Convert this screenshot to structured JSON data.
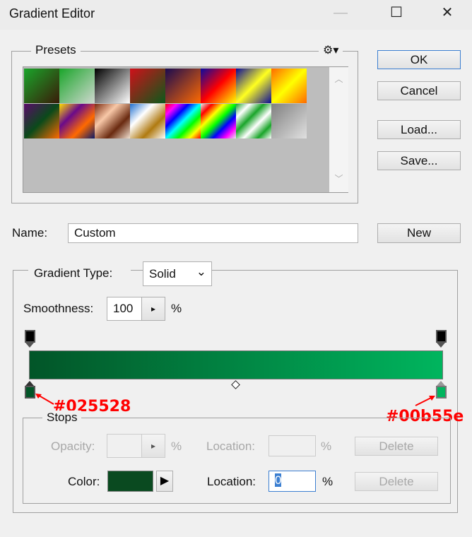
{
  "window": {
    "title": "Gradient Editor",
    "minimize": "—",
    "maximize": "☐",
    "close": "✕"
  },
  "presets": {
    "label": "Presets",
    "gear": "⚙▾",
    "scroll_up": "︿",
    "scroll_down": "﹀",
    "items": [
      [
        "135deg",
        "#1aa52a",
        "#3a1a08"
      ],
      [
        "135deg",
        "#1aa52a",
        "#cfd8cf"
      ],
      [
        "135deg",
        "#000000",
        "#ffffff"
      ],
      [
        "135deg",
        "#d0101a",
        "#0a5a1a"
      ],
      [
        "135deg",
        "#1a0a50",
        "#ff6a00"
      ],
      [
        "135deg",
        "#0a0aa0",
        "#ff0000",
        "#ffff00"
      ],
      [
        "135deg",
        "#0a0a9a",
        "#ffff20",
        "#0a0a9a"
      ],
      [
        "135deg",
        "#ff6a00",
        "#ffff00",
        "#ff6a00"
      ],
      [
        "135deg",
        "#5a0a6a",
        "#0a4a1a",
        "#ff6a00"
      ],
      [
        "135deg",
        "#ffe000",
        "#6a0a8a",
        "#ff6a00",
        "#0a1a6a"
      ],
      [
        "135deg",
        "#7a2a10",
        "#f8c8a8",
        "#6a2a10",
        "#f0e0d0"
      ],
      [
        "135deg",
        "#2070d0",
        "#ffffff",
        "#b07a10",
        "#ffffff"
      ],
      [
        "135deg",
        "#ff0000",
        "#ff00ff",
        "#0000ff",
        "#00ffff",
        "#00ff00",
        "#ffff00",
        "#ff0000"
      ],
      [
        "135deg",
        "#e8e8e8",
        "#ff0000",
        "#ffff00",
        "#00ff00",
        "#0000ff",
        "#ff00ff",
        "#e8e8e8"
      ],
      [
        "135deg",
        "#1aa52a",
        "#ffffff",
        "#1aa52a",
        "#ffffff",
        "#1aa52a",
        "#ffffff"
      ],
      [
        "135deg",
        "#808080",
        "#e0e0e0"
      ]
    ]
  },
  "buttons": {
    "ok": "OK",
    "cancel": "Cancel",
    "load": "Load...",
    "save": "Save...",
    "new": "New"
  },
  "name": {
    "label": "Name:",
    "value": "Custom"
  },
  "gradient_type": {
    "label": "Gradient Type:",
    "value": "Solid",
    "chevron": "⌄"
  },
  "smoothness": {
    "label": "Smoothness:",
    "value": "100",
    "unit": "%",
    "arrow": "▸"
  },
  "gradient": {
    "start_color": "#025528",
    "end_color": "#00b55e",
    "opacity_stop_color": "#000000"
  },
  "annotations": {
    "left": "#025528",
    "right": "#00b55e"
  },
  "stops": {
    "label": "Stops",
    "opacity": {
      "label": "Opacity:",
      "value": "",
      "unit": "%",
      "arrow": "▸",
      "location_label": "Location:",
      "location_value": "",
      "location_unit": "%",
      "delete": "Delete"
    },
    "color": {
      "label": "Color:",
      "swatch": "#0a4a20",
      "arrow": "▶",
      "location_label": "Location:",
      "location_value": "0",
      "location_unit": "%",
      "delete": "Delete"
    }
  }
}
